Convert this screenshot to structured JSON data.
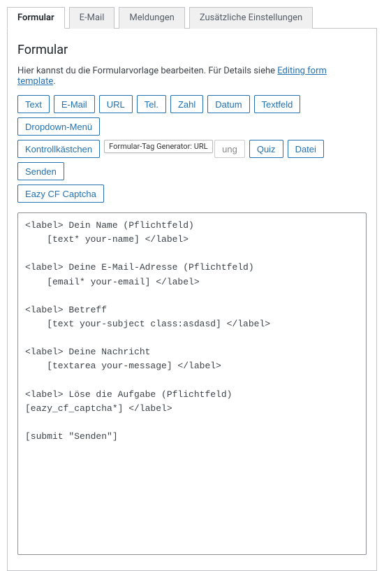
{
  "tabs": {
    "formular": "Formular",
    "email": "E-Mail",
    "meldungen": "Meldungen",
    "zusaetzlich": "Zusätzliche Einstellungen"
  },
  "section": {
    "title": "Formular",
    "desc_prefix": "Hier kannst du die Formularvorlage bearbeiten. Für Details siehe ",
    "desc_link": "Editing form template",
    "desc_suffix": "."
  },
  "tag_buttons": {
    "text": "Text",
    "email": "E-Mail",
    "url": "URL",
    "tel": "Tel.",
    "zahl": "Zahl",
    "datum": "Datum",
    "textfeld": "Textfeld",
    "dropdown": "Dropdown-Menü",
    "kontrollkaestchen": "Kontrollkästchen",
    "zustimmung_visible": "ung",
    "quiz": "Quiz",
    "datei": "Datei",
    "senden": "Senden",
    "eazy": "Eazy CF Captcha"
  },
  "tooltip": "Formular-Tag Generator: URL",
  "editor_content": "<label> Dein Name (Pflichtfeld)\n    [text* your-name] </label>\n\n<label> Deine E-Mail-Adresse (Pflichtfeld)\n    [email* your-email] </label>\n\n<label> Betreff\n    [text your-subject class:asdasd] </label>\n\n<label> Deine Nachricht\n    [textarea your-message] </label>\n\n<label> Löse die Aufgabe (Pflichtfeld)\n[eazy_cf_captcha*] </label>\n\n[submit \"Senden\"]"
}
